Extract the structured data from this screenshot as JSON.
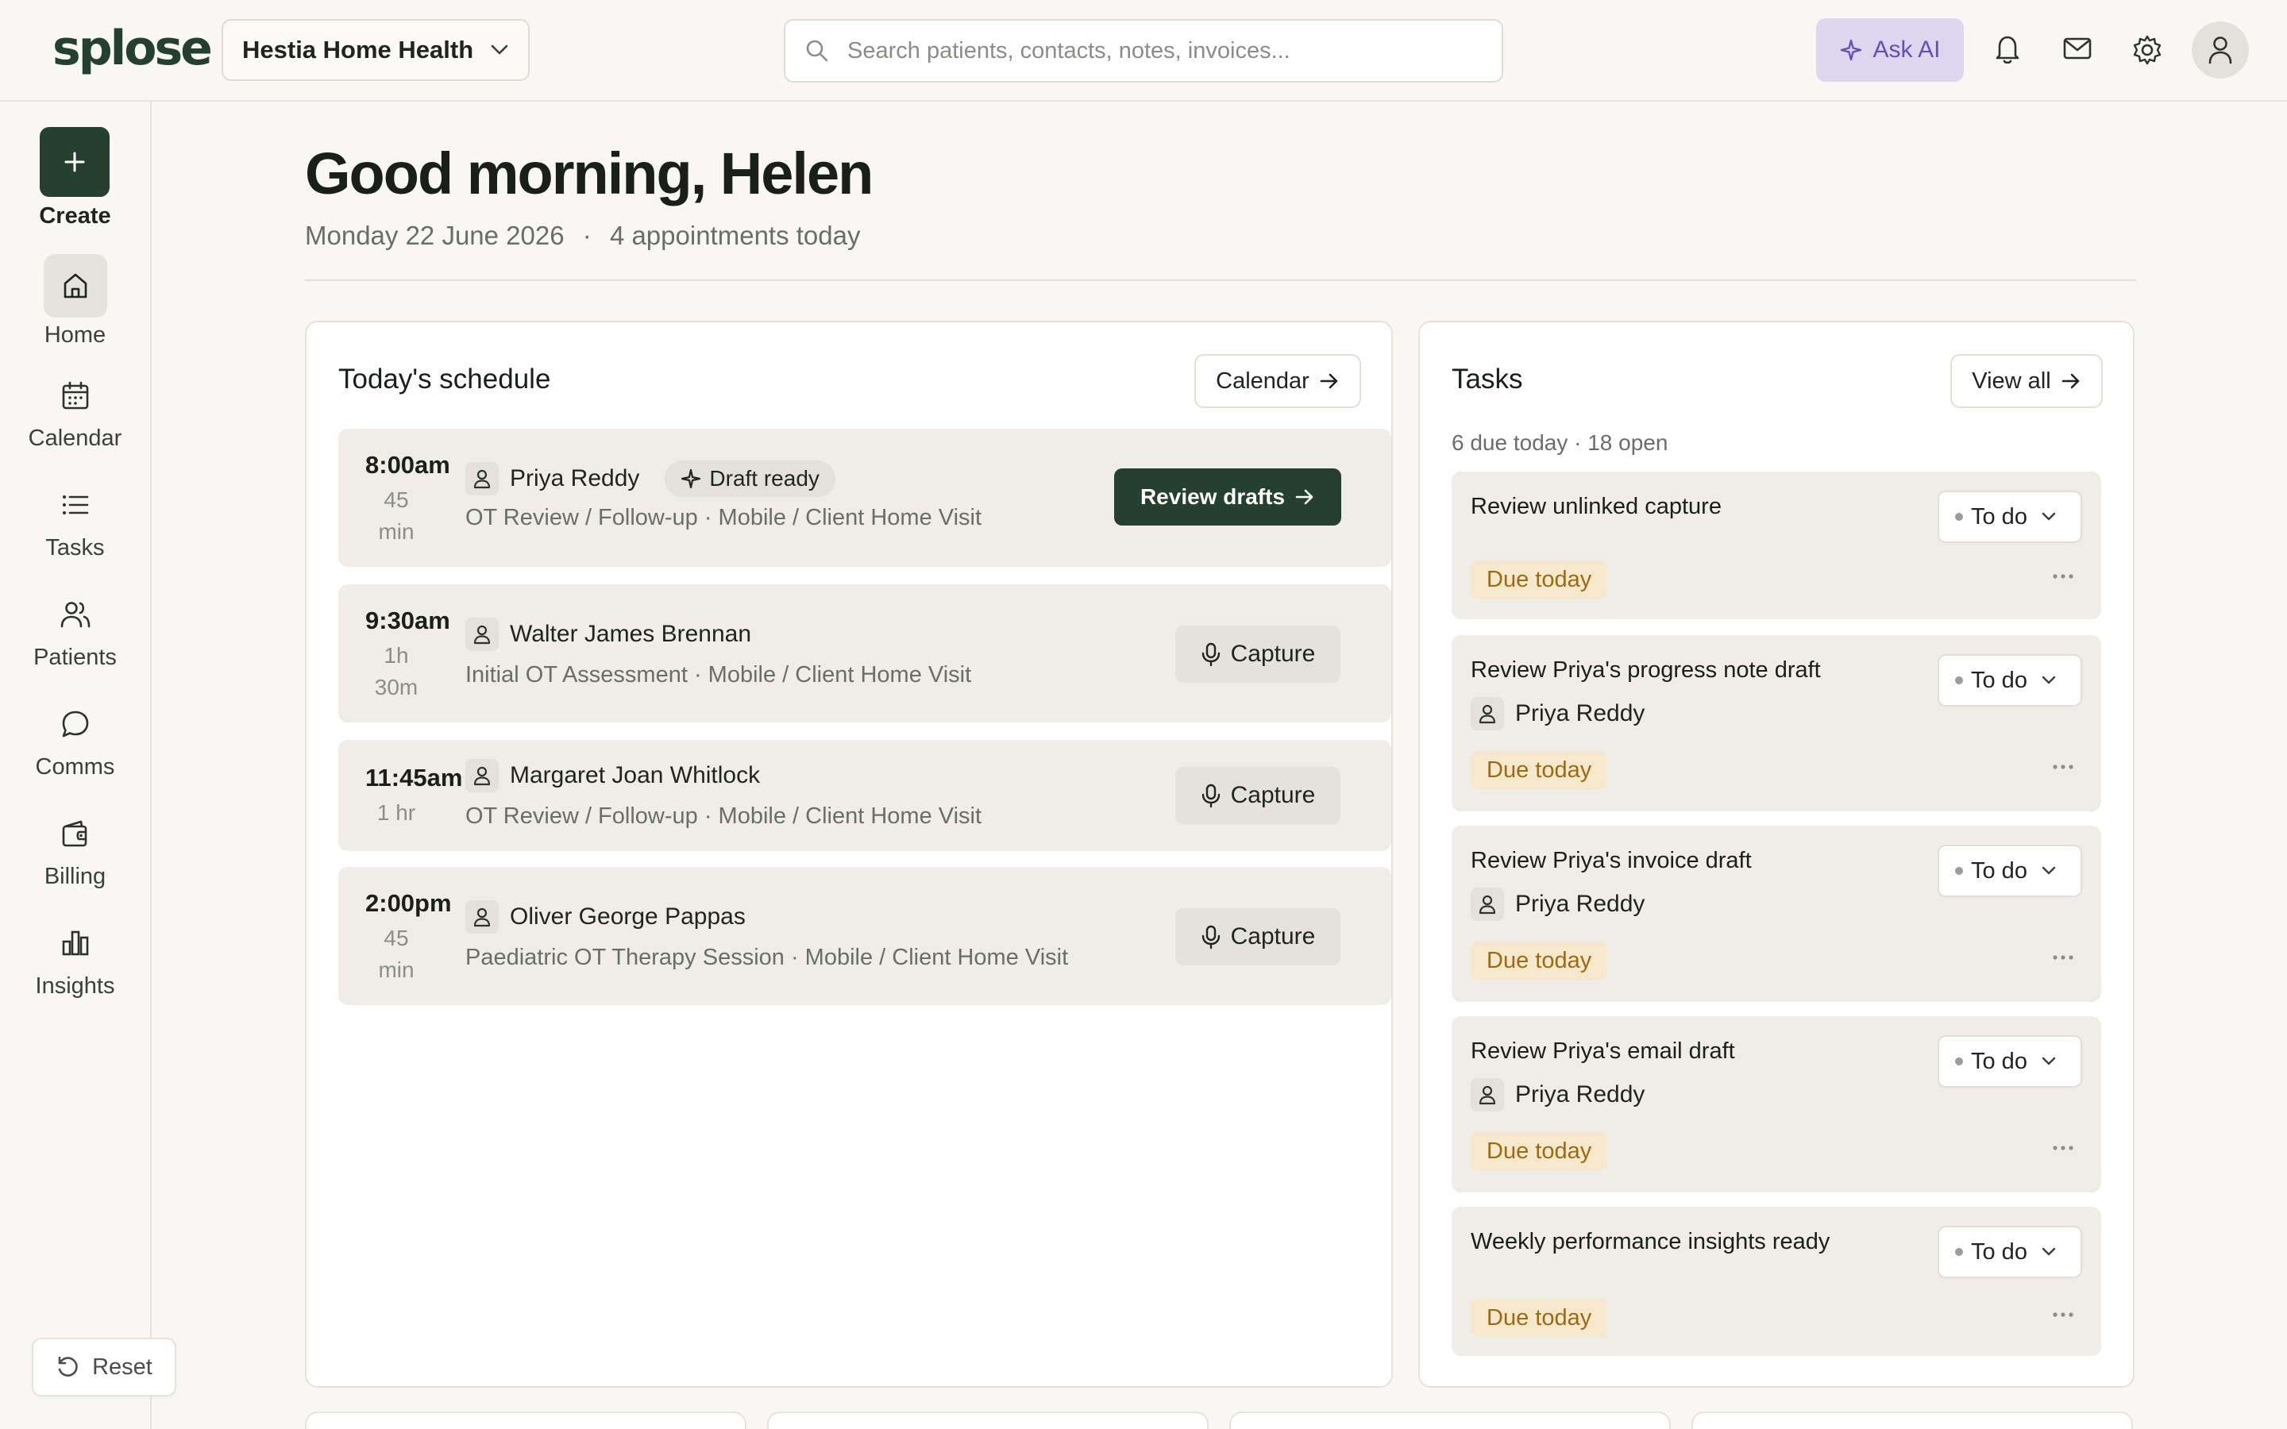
{
  "brand": {
    "logo": "splose",
    "accent": "#26402f",
    "ai_accent": "#6a4fb3"
  },
  "topbar": {
    "org_name": "Hestia Home Health",
    "search_placeholder": "Search patients, contacts, notes, invoices...",
    "ask_ai_label": "Ask AI",
    "icons": [
      "bell-icon",
      "mail-icon",
      "gear-icon",
      "user-icon"
    ]
  },
  "sidebar": {
    "create_label": "Create",
    "items": [
      {
        "label": "Home",
        "icon": "home-icon",
        "active": true
      },
      {
        "label": "Calendar",
        "icon": "calendar-icon"
      },
      {
        "label": "Tasks",
        "icon": "list-icon"
      },
      {
        "label": "Patients",
        "icon": "users-icon"
      },
      {
        "label": "Comms",
        "icon": "chat-icon"
      },
      {
        "label": "Billing",
        "icon": "wallet-icon"
      },
      {
        "label": "Insights",
        "icon": "bar-chart-icon"
      }
    ],
    "reset_label": "Reset"
  },
  "greeting": {
    "title": "Good morning, Helen",
    "date": "Monday 22 June 2026",
    "separator": "·",
    "appointments_summary": "4 appointments today"
  },
  "schedule": {
    "title": "Today's schedule",
    "calendar_link": "Calendar",
    "appointments": [
      {
        "time": "8:00am",
        "duration_line1": "45",
        "duration_line2": "min",
        "patient": "Priya Reddy",
        "badge": "Draft ready",
        "detail": "OT Review / Follow-up · Mobile / Client Home Visit",
        "action": "Review drafts"
      },
      {
        "time": "9:30am",
        "duration_line1": "1h",
        "duration_line2": "30m",
        "patient": "Walter James Brennan",
        "detail": "Initial OT Assessment · Mobile / Client Home Visit",
        "action": "Capture"
      },
      {
        "time": "11:45am",
        "duration_line1": "1 hr",
        "patient": "Margaret Joan Whitlock",
        "detail": "OT Review / Follow-up · Mobile / Client Home Visit",
        "action": "Capture"
      },
      {
        "time": "2:00pm",
        "duration_line1": "45",
        "duration_line2": "min",
        "patient": "Oliver George Pappas",
        "detail": "Paediatric OT Therapy Session · Mobile / Client Home Visit",
        "action": "Capture"
      }
    ]
  },
  "tasks": {
    "title": "Tasks",
    "view_all": "View all",
    "meta": "6 due today · 18 open",
    "items": [
      {
        "title": "Review unlinked capture",
        "status": "To do",
        "due": "Due today"
      },
      {
        "title": "Review Priya's progress note draft",
        "person": "Priya Reddy",
        "status": "To do",
        "due": "Due today"
      },
      {
        "title": "Review Priya's invoice draft",
        "person": "Priya Reddy",
        "status": "To do",
        "due": "Due today"
      },
      {
        "title": "Review Priya's email draft",
        "person": "Priya Reddy",
        "status": "To do",
        "due": "Due today"
      },
      {
        "title": "Weekly performance insights ready",
        "status": "To do",
        "due": "Due today"
      }
    ]
  }
}
